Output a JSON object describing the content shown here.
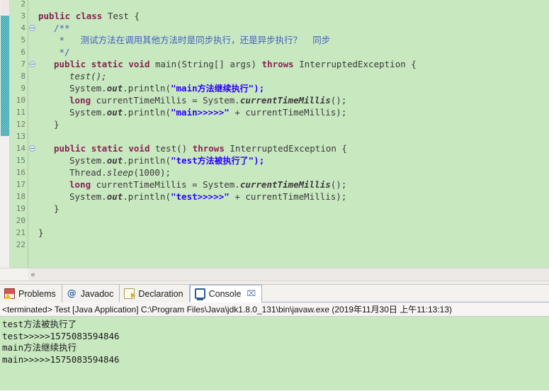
{
  "editor": {
    "name": "java-source-editor",
    "background_color": "#c8e8c0",
    "current_line": 6,
    "highlight_color": "#e8ecfb",
    "first_visible_line": 2,
    "last_visible_line": 22,
    "collapse_glyph": "«",
    "fold_lines": [
      4,
      7,
      14
    ],
    "lines": [
      {
        "num": "2",
        "indent": 0,
        "segments": []
      },
      {
        "num": "3",
        "indent": 0,
        "segments": [
          {
            "t": "public",
            "c": "kw"
          },
          {
            "t": " ",
            "c": "id"
          },
          {
            "t": "class",
            "c": "kw"
          },
          {
            "t": " Test {",
            "c": "id"
          }
        ]
      },
      {
        "num": "4",
        "indent": 1,
        "segments": [
          {
            "t": "/**",
            "c": "cmt"
          }
        ]
      },
      {
        "num": "5",
        "indent": 1,
        "segments": [
          {
            "t": " *   ",
            "c": "cmt"
          },
          {
            "t": "测试方法在调用其他方法时是同步执行，还是异步执行？  同步",
            "c": "cmt"
          }
        ]
      },
      {
        "num": "6",
        "indent": 1,
        "segments": [
          {
            "t": " */",
            "c": "cmt"
          }
        ]
      },
      {
        "num": "7",
        "indent": 1,
        "segments": [
          {
            "t": "public",
            "c": "kw"
          },
          {
            "t": " ",
            "c": "id"
          },
          {
            "t": "static",
            "c": "kw"
          },
          {
            "t": " ",
            "c": "id"
          },
          {
            "t": "void",
            "c": "kw"
          },
          {
            "t": " main(String[] ",
            "c": "id"
          },
          {
            "t": "args",
            "c": "id"
          },
          {
            "t": ") ",
            "c": "id"
          },
          {
            "t": "throws",
            "c": "kw"
          },
          {
            "t": " InterruptedException {",
            "c": "id"
          }
        ]
      },
      {
        "num": "8",
        "indent": 2,
        "segments": [
          {
            "t": "test();",
            "c": "stat"
          }
        ]
      },
      {
        "num": "9",
        "indent": 2,
        "segments": [
          {
            "t": "System.",
            "c": "id"
          },
          {
            "t": "out",
            "c": "statb"
          },
          {
            "t": ".println(",
            "c": "id"
          },
          {
            "t": "\"main",
            "c": "str"
          },
          {
            "t": "方法继续执行",
            "c": "cn"
          },
          {
            "t": "\");",
            "c": "str"
          }
        ]
      },
      {
        "num": "10",
        "indent": 2,
        "segments": [
          {
            "t": "long",
            "c": "kw"
          },
          {
            "t": " currentTimeMillis = System.",
            "c": "id"
          },
          {
            "t": "currentTimeMillis",
            "c": "statb"
          },
          {
            "t": "();",
            "c": "id"
          }
        ]
      },
      {
        "num": "11",
        "indent": 2,
        "segments": [
          {
            "t": "System.",
            "c": "id"
          },
          {
            "t": "out",
            "c": "statb"
          },
          {
            "t": ".println(",
            "c": "id"
          },
          {
            "t": "\"main>>>>>\"",
            "c": "str"
          },
          {
            "t": " + currentTimeMillis);",
            "c": "id"
          }
        ]
      },
      {
        "num": "12",
        "indent": 1,
        "segments": [
          {
            "t": "}",
            "c": "id"
          }
        ]
      },
      {
        "num": "13",
        "indent": 0,
        "segments": []
      },
      {
        "num": "14",
        "indent": 1,
        "segments": [
          {
            "t": "public",
            "c": "kw"
          },
          {
            "t": " ",
            "c": "id"
          },
          {
            "t": "static",
            "c": "kw"
          },
          {
            "t": " ",
            "c": "id"
          },
          {
            "t": "void",
            "c": "kw"
          },
          {
            "t": " test() ",
            "c": "id"
          },
          {
            "t": "throws",
            "c": "kw"
          },
          {
            "t": " InterruptedException {",
            "c": "id"
          }
        ]
      },
      {
        "num": "15",
        "indent": 2,
        "segments": [
          {
            "t": "System.",
            "c": "id"
          },
          {
            "t": "out",
            "c": "statb"
          },
          {
            "t": ".println(",
            "c": "id"
          },
          {
            "t": "\"test",
            "c": "str"
          },
          {
            "t": "方法被执行了",
            "c": "cn"
          },
          {
            "t": "\");",
            "c": "str"
          }
        ]
      },
      {
        "num": "16",
        "indent": 2,
        "segments": [
          {
            "t": "Thread.",
            "c": "id"
          },
          {
            "t": "sleep",
            "c": "stat"
          },
          {
            "t": "(1000);",
            "c": "id"
          }
        ]
      },
      {
        "num": "17",
        "indent": 2,
        "segments": [
          {
            "t": "long",
            "c": "kw"
          },
          {
            "t": " currentTimeMillis = System.",
            "c": "id"
          },
          {
            "t": "currentTimeMillis",
            "c": "statb"
          },
          {
            "t": "();",
            "c": "id"
          }
        ]
      },
      {
        "num": "18",
        "indent": 2,
        "segments": [
          {
            "t": "System.",
            "c": "id"
          },
          {
            "t": "out",
            "c": "statb"
          },
          {
            "t": ".println(",
            "c": "id"
          },
          {
            "t": "\"test>>>>>\"",
            "c": "str"
          },
          {
            "t": " + currentTimeMillis);",
            "c": "id"
          }
        ]
      },
      {
        "num": "19",
        "indent": 1,
        "segments": [
          {
            "t": "}",
            "c": "id"
          }
        ]
      },
      {
        "num": "20",
        "indent": 0,
        "segments": []
      },
      {
        "num": "21",
        "indent": 0,
        "segments": [
          {
            "t": "}",
            "c": "id"
          }
        ]
      },
      {
        "num": "22",
        "indent": 0,
        "segments": []
      }
    ]
  },
  "bottom_panel": {
    "tabs": [
      {
        "label": "Problems",
        "icon": "problems-icon",
        "active": false,
        "closable": false
      },
      {
        "label": "Javadoc",
        "icon": "javadoc-icon",
        "active": false,
        "closable": false
      },
      {
        "label": "Declaration",
        "icon": "declaration-icon",
        "active": false,
        "closable": false
      },
      {
        "label": "Console",
        "icon": "console-icon",
        "active": true,
        "closable": true
      }
    ],
    "close_glyph": "⌧",
    "javadoc_glyph": "@",
    "status_line": "<terminated> Test [Java Application] C:\\Program Files\\Java\\jdk1.8.0_131\\bin\\javaw.exe (2019年11月30日 上午11:13:13)",
    "console_background": "#c8e8c0",
    "output_lines": [
      {
        "ascii": "test",
        "cjk": "方法被执行了",
        "tail": ""
      },
      {
        "ascii": "test>>>>>1575083594846",
        "cjk": "",
        "tail": ""
      },
      {
        "ascii": "main",
        "cjk": "方法继续执行",
        "tail": ""
      },
      {
        "ascii": "main>>>>>1575083594846",
        "cjk": "",
        "tail": ""
      }
    ]
  }
}
